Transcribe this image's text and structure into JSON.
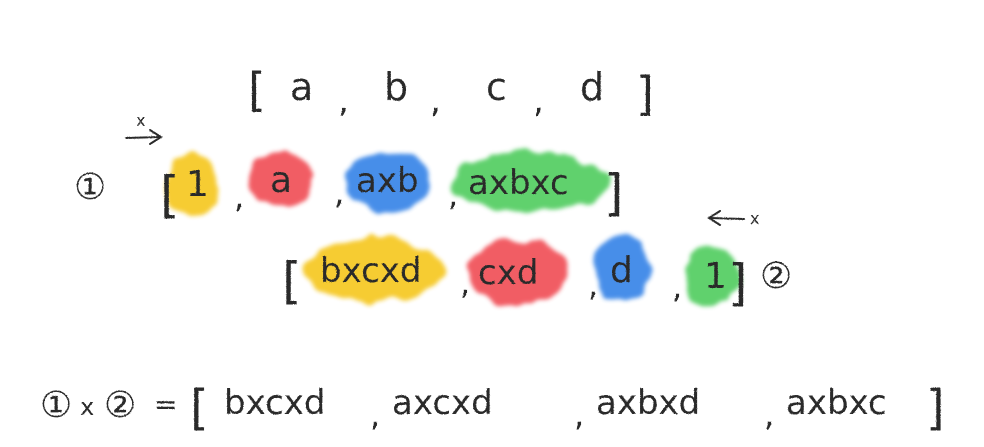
{
  "colors": {
    "ink": "#2b2b2b",
    "yellow": "#f5c518",
    "red": "#f0464f",
    "blue": "#2f7fe6",
    "green": "#4ccb5a"
  },
  "input_array": {
    "open": "[",
    "items": [
      "a",
      "b",
      "c",
      "d"
    ],
    "separator": ",",
    "close": "]"
  },
  "pass1": {
    "marker": "①",
    "direction_label": "x",
    "direction_icon": "arrow-right-icon",
    "open": "[",
    "close": "]",
    "items": [
      {
        "text": "1",
        "color": "#f5c518"
      },
      {
        "text": "a",
        "color": "#f0464f"
      },
      {
        "text": "axb",
        "color": "#2f7fe6"
      },
      {
        "text": "axbxc",
        "color": "#4ccb5a"
      }
    ],
    "separator": ","
  },
  "pass2": {
    "marker": "②",
    "direction_label": "x",
    "direction_icon": "arrow-left-icon",
    "open": "[",
    "close": "]",
    "items": [
      {
        "text": "bxcxd",
        "color": "#f5c518"
      },
      {
        "text": "cxd",
        "color": "#f0464f"
      },
      {
        "text": "d",
        "color": "#2f7fe6"
      },
      {
        "text": "1",
        "color": "#4ccb5a"
      }
    ],
    "separator": ","
  },
  "result": {
    "lhs_a": "①",
    "times": "x",
    "lhs_b": "②",
    "equals": "=",
    "open": "[",
    "items": [
      "bxcxd",
      "axcxd",
      "axbxd",
      "axbxc"
    ],
    "separator": ",",
    "close": "]"
  }
}
